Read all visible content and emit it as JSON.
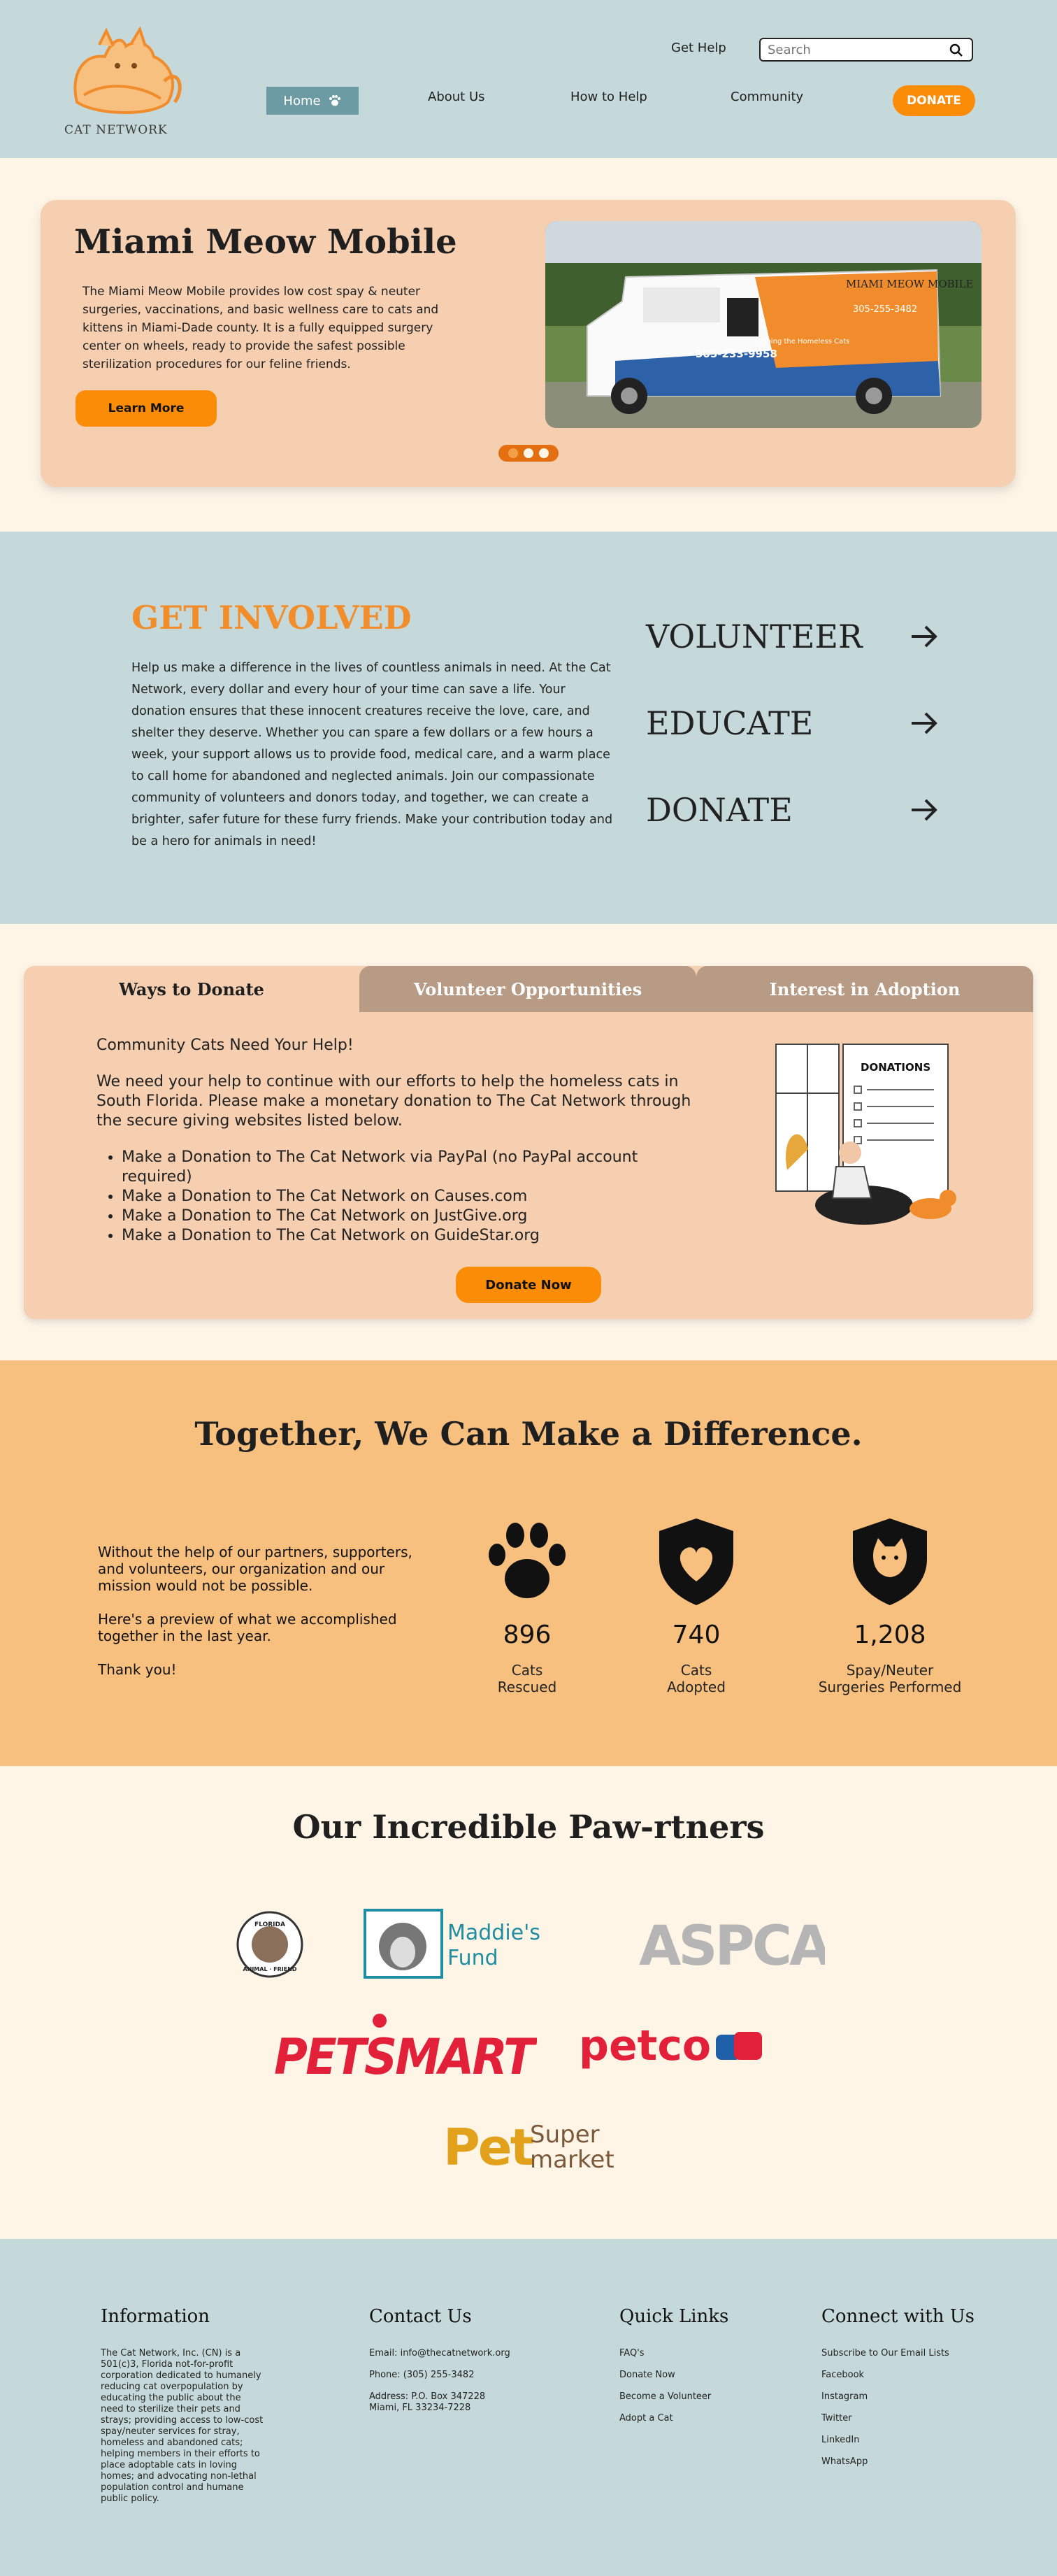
{
  "header": {
    "logo_text": "CAT NETWORK",
    "get_help": "Get Help",
    "search_placeholder": "Search",
    "nav": [
      "Home",
      "About Us",
      "How to Help",
      "Community"
    ],
    "donate": "DONATE"
  },
  "hero": {
    "title": "Miami Meow Mobile",
    "description": "The Miami Meow Mobile provides low cost spay & neuter surgeries,  vaccinations, and basic wellness care to cats and kittens in Miami-Dade county. It is a fully equipped surgery center on wheels, ready to provide the safest possible sterilization procedures for our feline friends.",
    "button": "Learn More",
    "van_title": "MIAMI MEOW MOBILE",
    "van_phone_1": "305-233-9958",
    "van_phone_2": "305-255-3482",
    "van_tagline": "Helping the Homeless Cats"
  },
  "involved": {
    "title": "GET INVOLVED",
    "text": "Help us make a difference in the lives of countless animals in need. At the Cat Network, every dollar and every hour of your time can save a life. Your donation ensures that these innocent creatures receive the love, care, and shelter they deserve. Whether you can spare a few dollars or a few hours a week, your support allows us to provide food, medical care, and a warm place to call home for abandoned and neglected animals. Join our compassionate community of volunteers and donors today, and together, we can create a brighter, safer future for these furry friends. Make your contribution today and be a hero for animals in need!",
    "links": [
      "VOLUNTEER",
      "EDUCATE",
      "DONATE"
    ]
  },
  "tabs": {
    "labels": [
      "Ways to Donate",
      "Volunteer Opportunities",
      "Interest in Adoption"
    ],
    "heading": "Community Cats Need Your Help!",
    "intro": "We need your help to continue with our efforts to help the homeless cats in South Florida. Please make a monetary donation to The Cat Network through the secure giving websites listed below.",
    "list": [
      "Make a Donation to The Cat Network via PayPal (no PayPal account required)",
      "Make a Donation to The Cat Network on Causes.com",
      "Make a Donation to The Cat Network on JustGive.org",
      "Make a Donation to The Cat Network on GuideStar.org"
    ],
    "button": "Donate Now",
    "illustration_label": "DONATIONS"
  },
  "stats": {
    "title": "Together, We Can Make a Difference.",
    "p1": "Without the help of our partners, supporters, and volunteers, our organization and our mission  would not be possible.",
    "p2": "Here's a preview of what we accomplished together  in the last year.",
    "p3": "Thank you!",
    "items": [
      {
        "icon": "paw-icon",
        "value": "896",
        "label_1": "Cats",
        "label_2": "Rescued"
      },
      {
        "icon": "heart-shield-icon",
        "value": "740",
        "label_1": "Cats",
        "label_2": "Adopted"
      },
      {
        "icon": "cat-shield-icon",
        "value": "1,208",
        "label_1": "Spay/Neuter",
        "label_2": "Surgeries Performed"
      }
    ]
  },
  "partners": {
    "title": "Our Incredible Paw-rtners",
    "logos": {
      "ffa_top": "FLORIDA",
      "ffa_bottom": "ANIMAL · FRIEND",
      "maddie_1": "Maddie's",
      "maddie_2": "Fund",
      "aspca": "ASPCA",
      "petsmart": "PETSMART",
      "petco": "petco",
      "petsuper_1": "Pet",
      "petsuper_2": "Super",
      "petsuper_3": "market"
    }
  },
  "footer": {
    "info": {
      "heading": "Information",
      "text": "The Cat Network, Inc. (CN) is a 501(c)3,  Florida not-for-profit corporation dedicated to humanely reducing cat overpopulation by educating the public about the need to sterilize their pets and strays; providing access to low-cost spay/neuter services for stray, homeless and abandoned cats; helping members in their efforts to place adoptable cats in loving homes; and advocating non-lethal population control and humane public policy."
    },
    "contact": {
      "heading": "Contact Us",
      "email": "Email: info@thecatnetwork.org",
      "phone": "Phone: (305) 255-3482",
      "address_1": "Address: P.O. Box 347228",
      "address_2": "Miami, FL 33234-7228"
    },
    "quick": {
      "heading": "Quick Links",
      "links": [
        "FAQ's",
        "Donate Now",
        "Become a Volunteer",
        "Adopt a Cat"
      ]
    },
    "connect": {
      "heading": "Connect with Us",
      "links": [
        "Subscribe to Our Email Lists",
        "Facebook",
        "Instagram",
        "Twitter",
        "LinkedIn",
        "WhatsApp"
      ]
    }
  },
  "colors": {
    "header_bg": "#c6d9da",
    "page_bg": "#fef5e7",
    "accent_orange": "#fb8c08",
    "card_peach": "#f5cfb0",
    "tab_inactive": "#b89b84",
    "stats_bg": "#f8c07f",
    "nav_active": "#6c9ba3"
  }
}
